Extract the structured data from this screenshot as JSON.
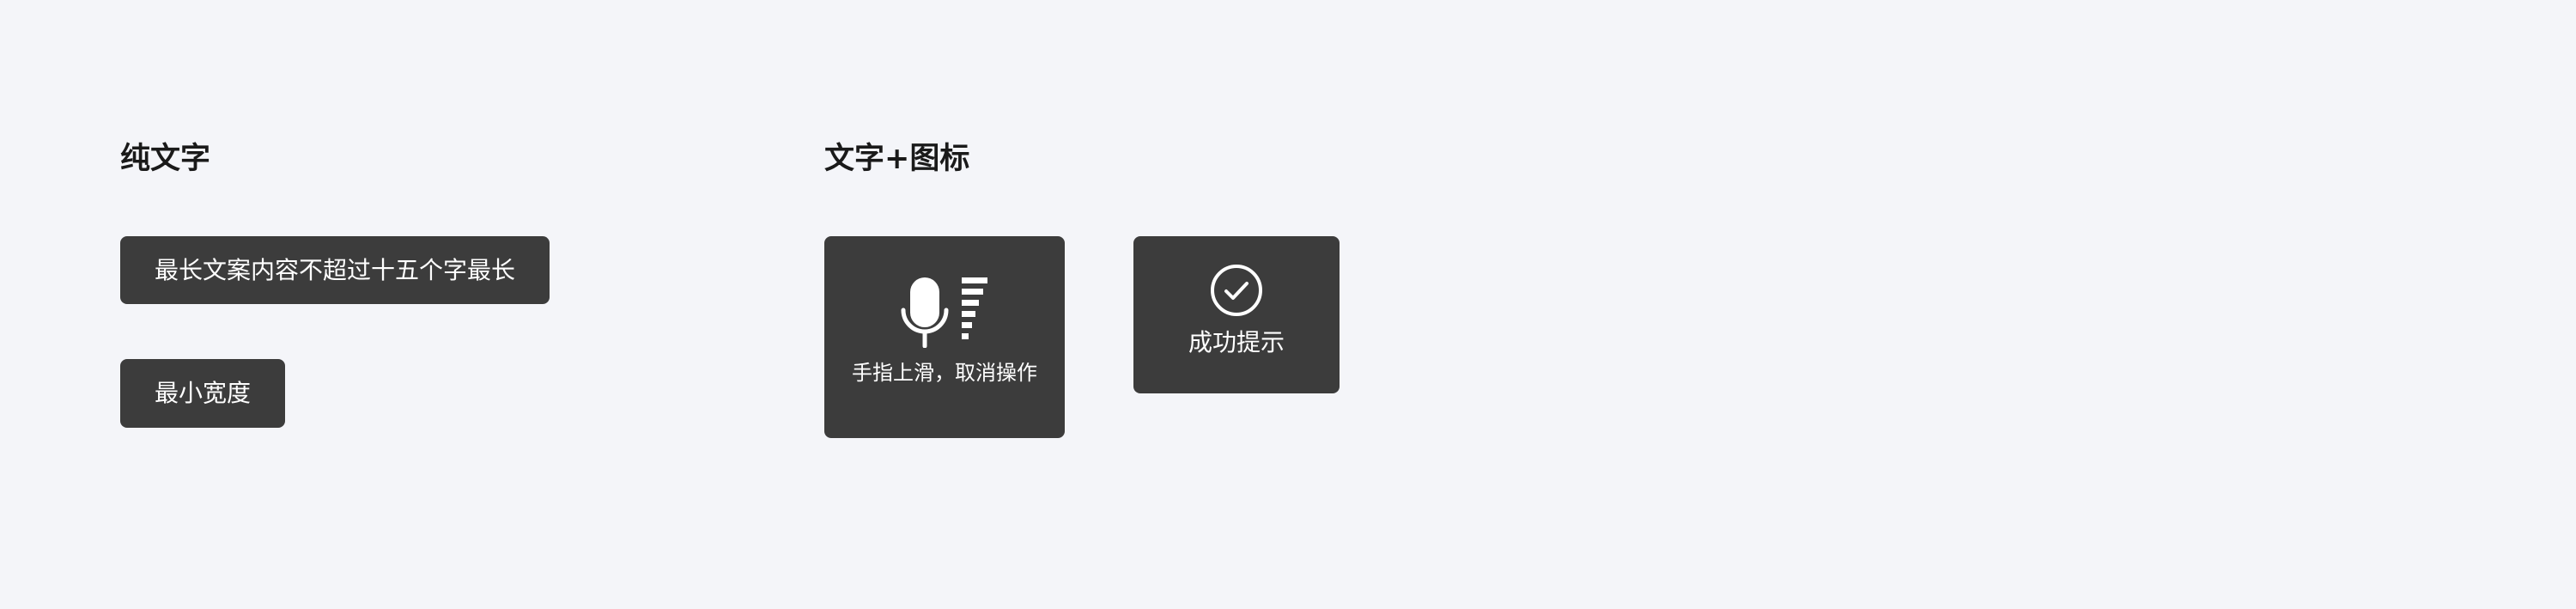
{
  "sections": {
    "text_only": {
      "title": "纯文字",
      "toast_max": "最长文案内容不超过十五个字最长",
      "toast_min": "最小宽度"
    },
    "text_icon": {
      "title": "文字+图标",
      "toast_voice": {
        "icon": "microphone-volume-icon",
        "label": "手指上滑，取消操作"
      },
      "toast_success": {
        "icon": "check-circle-icon",
        "label": "成功提示"
      }
    }
  },
  "colors": {
    "background": "#f4f5f9",
    "toast_bg": "#3c3c3c",
    "toast_text": "#ffffff",
    "title_text": "#1a1a1a"
  }
}
